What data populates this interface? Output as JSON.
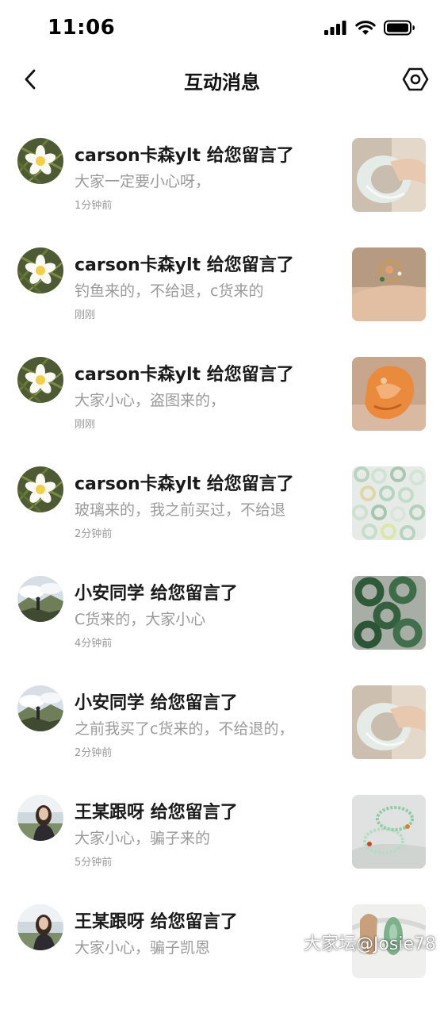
{
  "status_bar": {
    "time": "11:06"
  },
  "header": {
    "title": "互动消息"
  },
  "messages": [
    {
      "user": "carson卡森ylt",
      "action": "给您留言了",
      "text": "大家一定要小心呀，",
      "time": "1分钟前",
      "avatar": "flower-avatar",
      "thumbnail": "jade-bangle-photo"
    },
    {
      "user": "carson卡森ylt",
      "action": "给您留言了",
      "text": "钓鱼来的，不给退，c货来的",
      "time": "刚刚",
      "avatar": "flower-avatar",
      "thumbnail": "jade-ring-photo"
    },
    {
      "user": "carson卡森ylt",
      "action": "给您留言了",
      "text": "大家小心，盗图来的，",
      "time": "刚刚",
      "avatar": "flower-avatar",
      "thumbnail": "orange-jade-carving-photo"
    },
    {
      "user": "carson卡森ylt",
      "action": "给您留言了",
      "text": "玻璃来的，我之前买过，不给退",
      "time": "2分钟前",
      "avatar": "flower-avatar",
      "thumbnail": "jade-beads-photo"
    },
    {
      "user": "小安同学",
      "action": "给您留言了",
      "text": "C货来的，大家小心",
      "time": "4分钟前",
      "avatar": "landscape-avatar",
      "thumbnail": "green-jade-rings-photo"
    },
    {
      "user": "小安同学",
      "action": "给您留言了",
      "text": "之前我买了c货来的，不给退的，",
      "time": "2分钟前",
      "avatar": "landscape-avatar",
      "thumbnail": "jade-bangle-photo"
    },
    {
      "user": "王某跟呀",
      "action": "给您留言了",
      "text": "大家小心，骗子来的",
      "time": "5分钟前",
      "avatar": "portrait-avatar",
      "thumbnail": "bead-bracelets-photo"
    },
    {
      "user": "王某跟呀",
      "action": "给您留言了",
      "text": "大家小心，骗子凯恩",
      "time": "",
      "avatar": "portrait-avatar",
      "thumbnail": "jade-pendant-photo"
    }
  ],
  "watermark": "大家坛@Josie78"
}
